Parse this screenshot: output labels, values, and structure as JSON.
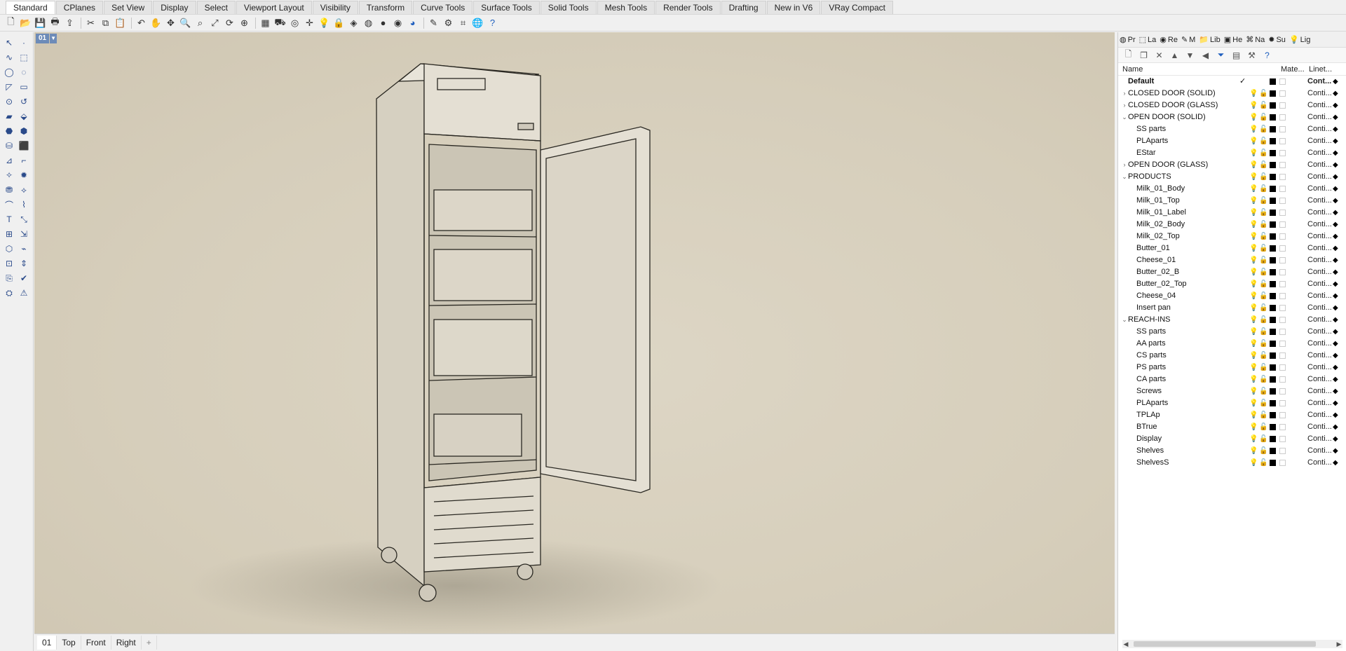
{
  "tabs": [
    "Standard",
    "CPlanes",
    "Set View",
    "Display",
    "Select",
    "Viewport Layout",
    "Visibility",
    "Transform",
    "Curve Tools",
    "Surface Tools",
    "Solid Tools",
    "Mesh Tools",
    "Render Tools",
    "Drafting",
    "New in V6",
    "VRay Compact"
  ],
  "toolbar_icons": [
    "new-file-icon",
    "open-file-icon",
    "save-icon",
    "print-icon",
    "import-icon",
    "cut-icon",
    "copy-icon",
    "paste-icon",
    "undo-icon",
    "pan-icon",
    "move-view-icon",
    "zoom-icon",
    "zoom-window-icon",
    "zoom-extents-icon",
    "rotate-view-icon",
    "zoom-selected-icon",
    "grid-icon",
    "car-icon",
    "snapshot-icon",
    "gumball-icon",
    "light-icon",
    "lock-icon",
    "material-icon",
    "color-wheel-icon",
    "render-sphere-icon",
    "shaded-sphere-icon",
    "globe-icon",
    "pen-icon",
    "gear-icon",
    "crop-icon",
    "globe-green-icon",
    "help-icon"
  ],
  "viewport": {
    "label": "01",
    "tabs": [
      "01",
      "Top",
      "Front",
      "Right"
    ],
    "add_tab": "+"
  },
  "panel": {
    "tabs": [
      {
        "icon": "properties-icon",
        "label": "Pr"
      },
      {
        "icon": "layers-icon",
        "label": "La"
      },
      {
        "icon": "render-icon",
        "label": "Re"
      },
      {
        "icon": "materials-icon",
        "label": "M"
      },
      {
        "icon": "library-icon",
        "label": "Lib"
      },
      {
        "icon": "help-icon",
        "label": "He"
      },
      {
        "icon": "named-views-icon",
        "label": "Na"
      },
      {
        "icon": "sun-icon",
        "label": "Su"
      },
      {
        "icon": "lights-icon",
        "label": "Lig"
      }
    ],
    "columns": {
      "name": "Name",
      "material": "Mate...",
      "linetype": "Linet..."
    },
    "layers": [
      {
        "name": "Default",
        "level": 0,
        "expander": "",
        "current": "✓",
        "bold": true,
        "linetype": "Cont..."
      },
      {
        "name": "CLOSED DOOR (SOLID)",
        "level": 0,
        "expander": "›",
        "bulb_off": true,
        "linetype": "Conti..."
      },
      {
        "name": "CLOSED DOOR (GLASS)",
        "level": 0,
        "expander": "›",
        "bulb_off": true,
        "linetype": "Conti..."
      },
      {
        "name": "OPEN DOOR (SOLID)",
        "level": 0,
        "expander": "⌄",
        "linetype": "Conti..."
      },
      {
        "name": "SS parts",
        "level": 1,
        "expander": "",
        "linetype": "Conti..."
      },
      {
        "name": "PLAparts",
        "level": 1,
        "expander": "",
        "linetype": "Conti..."
      },
      {
        "name": "EStar",
        "level": 1,
        "expander": "",
        "linetype": "Conti..."
      },
      {
        "name": "OPEN DOOR (GLASS)",
        "level": 0,
        "expander": "›",
        "bulb_off": true,
        "linetype": "Conti..."
      },
      {
        "name": "PRODUCTS",
        "level": 0,
        "expander": "⌄",
        "linetype": "Conti..."
      },
      {
        "name": "Milk_01_Body",
        "level": 1,
        "expander": "",
        "linetype": "Conti..."
      },
      {
        "name": "Milk_01_Top",
        "level": 1,
        "expander": "",
        "linetype": "Conti..."
      },
      {
        "name": "Milk_01_Label",
        "level": 1,
        "expander": "",
        "linetype": "Conti..."
      },
      {
        "name": "Milk_02_Body",
        "level": 1,
        "expander": "",
        "linetype": "Conti..."
      },
      {
        "name": "Milk_02_Top",
        "level": 1,
        "expander": "",
        "linetype": "Conti..."
      },
      {
        "name": "Butter_01",
        "level": 1,
        "expander": "",
        "linetype": "Conti..."
      },
      {
        "name": "Cheese_01",
        "level": 1,
        "expander": "",
        "linetype": "Conti..."
      },
      {
        "name": "Butter_02_B",
        "level": 1,
        "expander": "",
        "linetype": "Conti..."
      },
      {
        "name": "Butter_02_Top",
        "level": 1,
        "expander": "",
        "linetype": "Conti..."
      },
      {
        "name": "Cheese_04",
        "level": 1,
        "expander": "",
        "linetype": "Conti..."
      },
      {
        "name": "Insert pan",
        "level": 1,
        "expander": "",
        "linetype": "Conti..."
      },
      {
        "name": "REACH-INS",
        "level": 0,
        "expander": "⌄",
        "linetype": "Conti..."
      },
      {
        "name": "SS parts",
        "level": 1,
        "expander": "",
        "linetype": "Conti..."
      },
      {
        "name": "AA parts",
        "level": 1,
        "expander": "",
        "linetype": "Conti..."
      },
      {
        "name": "CS parts",
        "level": 1,
        "expander": "",
        "linetype": "Conti..."
      },
      {
        "name": "PS parts",
        "level": 1,
        "expander": "",
        "linetype": "Conti..."
      },
      {
        "name": "CA parts",
        "level": 1,
        "expander": "",
        "linetype": "Conti..."
      },
      {
        "name": "Screws",
        "level": 1,
        "expander": "",
        "linetype": "Conti..."
      },
      {
        "name": "PLAparts",
        "level": 1,
        "expander": "",
        "linetype": "Conti..."
      },
      {
        "name": "TPLAp",
        "level": 1,
        "expander": "",
        "linetype": "Conti..."
      },
      {
        "name": "BTrue",
        "level": 1,
        "expander": "",
        "linetype": "Conti..."
      },
      {
        "name": "Display",
        "level": 1,
        "expander": "",
        "linetype": "Conti..."
      },
      {
        "name": "Shelves",
        "level": 1,
        "expander": "",
        "linetype": "Conti..."
      },
      {
        "name": "ShelvesS",
        "level": 1,
        "expander": "",
        "linetype": "Conti..."
      }
    ]
  }
}
